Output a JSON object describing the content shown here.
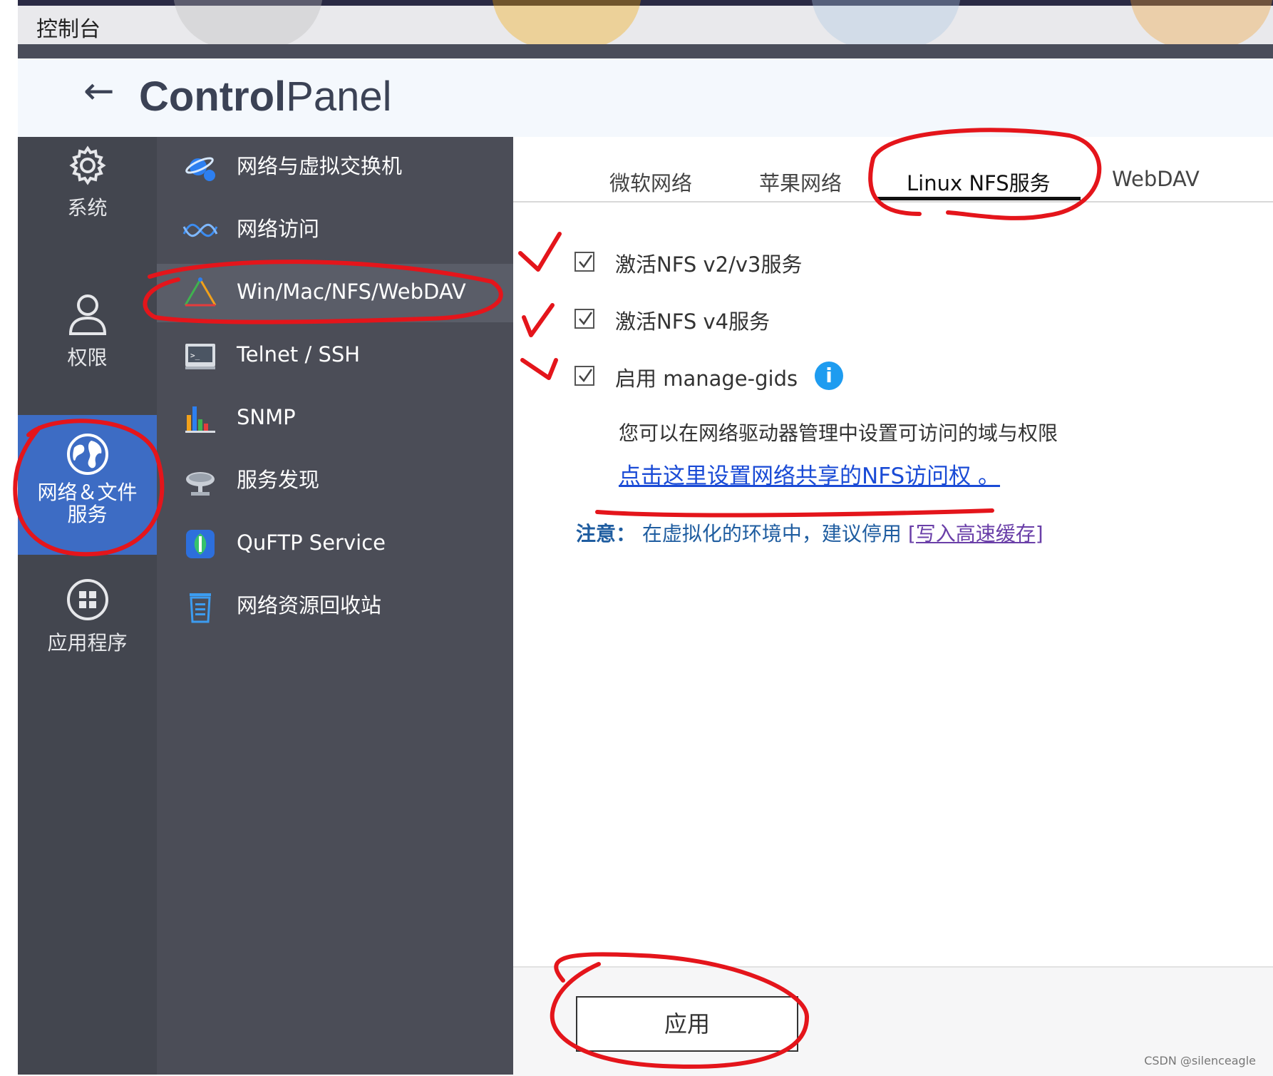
{
  "os_bar": {
    "title": "控制台"
  },
  "header": {
    "back_icon": "arrow-left-icon",
    "title_bold": "Control",
    "title_thin": "Panel"
  },
  "rail": {
    "items": [
      {
        "label": "系统",
        "icon": "gear-icon"
      },
      {
        "label": "权限",
        "icon": "user-icon"
      },
      {
        "label_line1": "网络＆文件",
        "label_line2": "服务",
        "icon": "globe-icon",
        "active": true
      },
      {
        "label": "应用程序",
        "icon": "apps-grid-icon"
      }
    ]
  },
  "nav": {
    "items": [
      {
        "label": "网络与虚拟交换机",
        "icon": "virtual-switch-icon"
      },
      {
        "label": "网络访问",
        "icon": "network-access-icon"
      },
      {
        "label": "Win/Mac/NFS/WebDAV",
        "icon": "file-services-icon",
        "active": true
      },
      {
        "label": "Telnet / SSH",
        "icon": "terminal-icon"
      },
      {
        "label": "SNMP",
        "icon": "snmp-chart-icon"
      },
      {
        "label": "服务发现",
        "icon": "satellite-dish-icon"
      },
      {
        "label": "QuFTP Service",
        "icon": "ftp-icon"
      },
      {
        "label": "网络资源回收站",
        "icon": "recycle-bin-icon"
      }
    ]
  },
  "tabs": [
    {
      "label": "微软网络"
    },
    {
      "label": "苹果网络"
    },
    {
      "label": "Linux NFS服务",
      "active": true
    },
    {
      "label": "WebDAV"
    }
  ],
  "options": [
    {
      "label": "激活NFS v2/v3服务",
      "checked": true
    },
    {
      "label": "激活NFS v4服务",
      "checked": true
    },
    {
      "label": "启用 manage-gids",
      "checked": true
    }
  ],
  "info_icon": "i",
  "description": "您可以在网络驱动器管理中设置可访问的域与权限",
  "link_text": "点击这里设置网络共享的NFS访问权 。",
  "note": {
    "label": "注意：",
    "text": "在虚拟化的环境中，建议停用",
    "link": "[写入高速缓存]"
  },
  "apply_button": "应用",
  "watermark": "CSDN @silenceagle",
  "colors": {
    "rail_bg": "#43464f",
    "nav_bg": "#4b4d57",
    "accent_active": "#3d6cc4",
    "annotation_red": "#e4151b",
    "link_blue": "#1a4bd6"
  }
}
